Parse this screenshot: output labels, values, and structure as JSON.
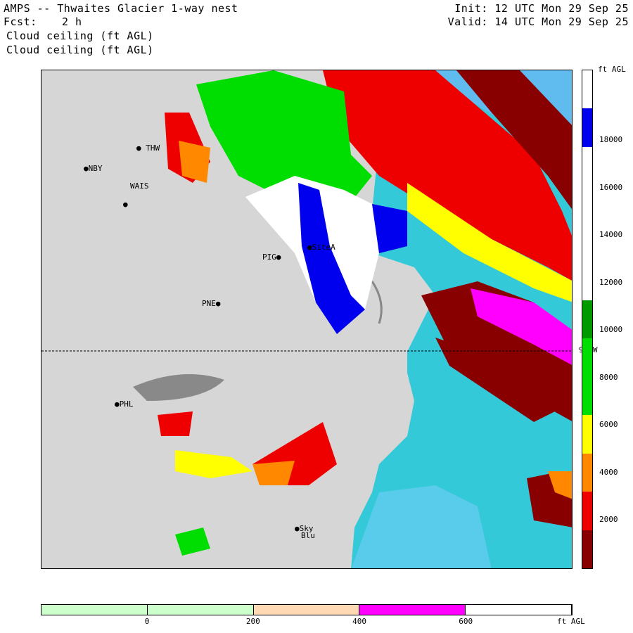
{
  "header": {
    "title": "AMPS -- Thwaites Glacier 1-way nest",
    "forecast_label": "Fcst:",
    "forecast_value": "2 h",
    "field_line1": "Cloud ceiling (ft AGL)",
    "field_line2": "Cloud ceiling (ft AGL)",
    "init": "Init: 12 UTC Mon 29 Sep 25",
    "valid": "Valid: 14 UTC Mon 29 Sep 25"
  },
  "map": {
    "meridian_label": "90 W",
    "stations": [
      {
        "id": "THW",
        "label": "THW"
      },
      {
        "id": "NBY",
        "label": "NBY"
      },
      {
        "id": "WAIS",
        "label": "WAIS"
      },
      {
        "id": "SiteA",
        "label": "SiteA"
      },
      {
        "id": "PIG",
        "label": "PIG"
      },
      {
        "id": "PNE",
        "label": "PNE"
      },
      {
        "id": "PHL",
        "label": "PHL"
      },
      {
        "id": "Sky",
        "label": "Sky"
      },
      {
        "id": "Blu",
        "label": "Blu"
      }
    ]
  },
  "right_colorbar": {
    "unit": "ft AGL",
    "ticks": [
      "18000",
      "16000",
      "14000",
      "12000",
      "10000",
      "8000",
      "6000",
      "4000",
      "2000"
    ],
    "colors": [
      "#ffffff",
      "#0000ee",
      "#ffffff",
      "#ffffff",
      "#ffffff",
      "#ffffff",
      "#009900",
      "#00dd00",
      "#00dd00",
      "#ffff00",
      "#ff8800",
      "#ee0000",
      "#880000"
    ]
  },
  "bottom_colorbar": {
    "unit": "ft AGL",
    "ticks": [
      "0",
      "200",
      "400",
      "600"
    ],
    "colors": [
      "#ccffcc",
      "#ccffcc",
      "#ffd9b3",
      "#ff00ff",
      "#ffffff"
    ]
  }
}
